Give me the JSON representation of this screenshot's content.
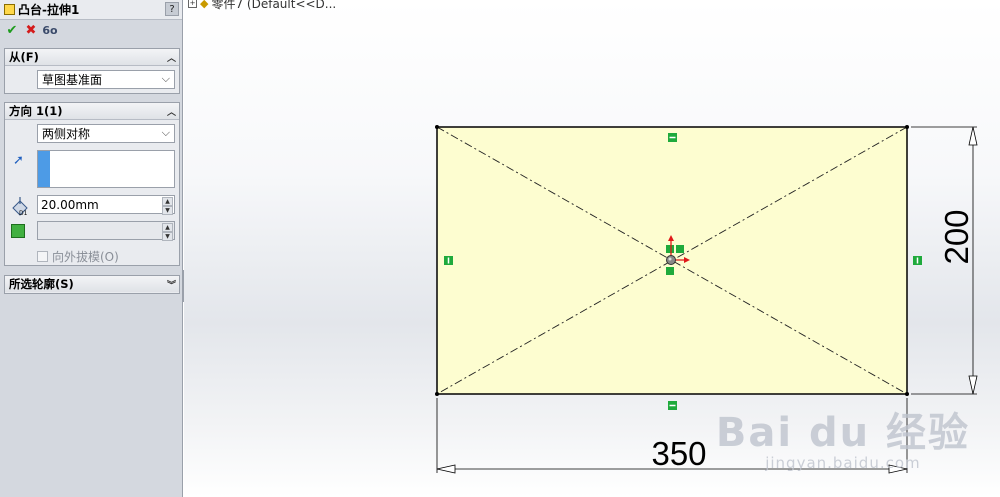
{
  "property_manager": {
    "title": "凸台-拉伸1",
    "help_label": "?",
    "actions": {
      "ok_glyph": "✔",
      "cancel_glyph": "✖",
      "preview_glyph": "6o"
    },
    "from_group": {
      "title": "从(F)",
      "collapse_glyph": "︿",
      "start_condition": "草图基准面",
      "dropdown_arrow": "⌵"
    },
    "direction_group": {
      "title": "方向 1(1)",
      "collapse_glyph": "︿",
      "end_condition": "两侧对称",
      "dropdown_arrow": "⌵",
      "direction_icon": "arrow-icon",
      "depth_value": "20.00mm",
      "depth_icon_label": "D1",
      "draft_value": "",
      "draft_checkbox_label": "向外拔模(O)",
      "spin_up": "▲",
      "spin_down": "▼"
    },
    "profiles_group": {
      "title": "所选轮廓(S)",
      "expand_glyph": "︾"
    },
    "splitter_glyph": "‹‹"
  },
  "viewport": {
    "tree_node_label": "零件7 (Default<<D...",
    "tree_expander": "+",
    "tree_icon": "part-icon",
    "dimensions": {
      "width_label": "350",
      "height_label": "200"
    },
    "watermark": {
      "main": "Bai du 经验",
      "sub": "jingyan.baidu.com"
    }
  },
  "colors": {
    "panel_bg": "#d4d8df",
    "sketch_fill": "#fdfdd0",
    "sketch_line": "#000000",
    "relation_green": "#1faa3c",
    "origin_red": "#e01818"
  }
}
